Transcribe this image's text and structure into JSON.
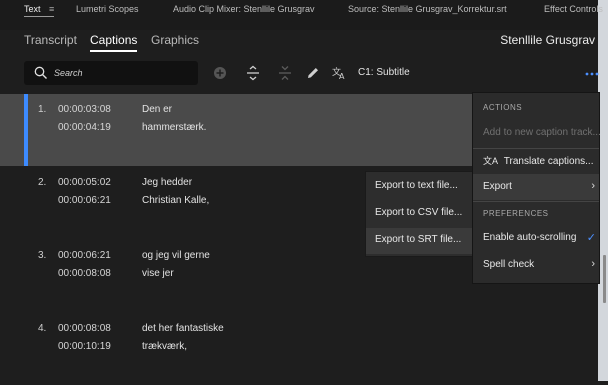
{
  "panel_tabs": [
    {
      "label": "Text",
      "active": true
    },
    {
      "label": "Lumetri Scopes"
    },
    {
      "label": "Audio Clip Mixer: Stenllile Grusgrav"
    },
    {
      "label": "Source: Stenllile Grusgrav_Korrektur.srt"
    },
    {
      "label": "Effect Controls"
    }
  ],
  "sub_tabs": [
    "Transcript",
    "Captions",
    "Graphics"
  ],
  "sequence_name": "Stenllile Grusgrav",
  "search": {
    "placeholder": "Search"
  },
  "track_label": "C1: Subtitle",
  "captions": [
    {
      "index": "1.",
      "start": "00:00:03:08",
      "end": "00:00:04:19",
      "line1": "Den er",
      "line2": "hammerstærk."
    },
    {
      "index": "2.",
      "start": "00:00:05:02",
      "end": "00:00:06:21",
      "line1": "Jeg hedder",
      "line2": "Christian Kalle,"
    },
    {
      "index": "3.",
      "start": "00:00:06:21",
      "end": "00:00:08:08",
      "line1": "og jeg vil gerne",
      "line2": "vise jer"
    },
    {
      "index": "4.",
      "start": "00:00:08:08",
      "end": "00:00:10:19",
      "line1": "det her fantastiske",
      "line2": "trækværk,"
    }
  ],
  "actions_menu": {
    "section_actions": "ACTIONS",
    "add_new": "Add to new caption track...",
    "translate": "Translate captions...",
    "export": "Export",
    "section_prefs": "PREFERENCES",
    "auto_scroll": "Enable auto-scrolling",
    "spell_check": "Spell check"
  },
  "export_submenu": [
    "Export to text file...",
    "Export to CSV file...",
    "Export to SRT file..."
  ],
  "colors": {
    "accent": "#3d8bff",
    "selected_row": "#4a4a4a"
  }
}
